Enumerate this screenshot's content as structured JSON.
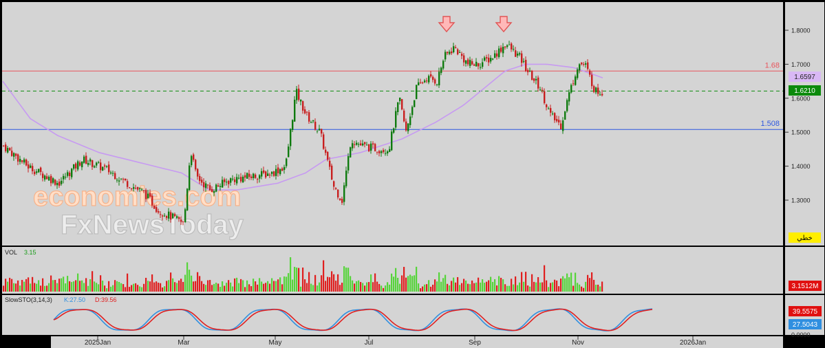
{
  "chart_data": [
    {
      "type": "candlestick",
      "panel": "price",
      "y_ticks": [
        "1.8000",
        "1.7000",
        "1.6000",
        "1.5000",
        "1.4000",
        "1.3000"
      ],
      "ylim": [
        1.2,
        1.85
      ],
      "x_ticks": [
        "2025Jan",
        "Mar",
        "May",
        "Jul",
        "Sep",
        "Nov",
        "2026Jan"
      ],
      "horizontal_lines": [
        {
          "label": "1.68",
          "value": 1.68,
          "color": "#e8545c"
        },
        {
          "label": "1.508",
          "value": 1.508,
          "color": "#2d57e0"
        },
        {
          "label": "1.6210",
          "value": 1.621,
          "color": "#0c8a0c",
          "style": "dashed"
        }
      ],
      "badges": [
        {
          "text": "1.6597",
          "bg": "#d9b8f5",
          "fg": "#222222"
        },
        {
          "text": "1.6210",
          "bg": "#0c8a0c",
          "fg": "#ffffff"
        },
        {
          "text": "خطي",
          "bg": "#ffee00",
          "fg": "#000000"
        }
      ],
      "close_trajectory_keypoints": [
        [
          0,
          1.46
        ],
        [
          35,
          1.4
        ],
        [
          80,
          1.35
        ],
        [
          115,
          1.42
        ],
        [
          150,
          1.39
        ],
        [
          180,
          1.35
        ],
        [
          205,
          1.32
        ],
        [
          225,
          1.27
        ],
        [
          245,
          1.25
        ],
        [
          262,
          1.23
        ],
        [
          272,
          1.45
        ],
        [
          280,
          1.37
        ],
        [
          300,
          1.33
        ],
        [
          330,
          1.36
        ],
        [
          360,
          1.37
        ],
        [
          390,
          1.38
        ],
        [
          410,
          1.4
        ],
        [
          425,
          1.62
        ],
        [
          440,
          1.55
        ],
        [
          460,
          1.5
        ],
        [
          480,
          1.34
        ],
        [
          492,
          1.3
        ],
        [
          505,
          1.48
        ],
        [
          520,
          1.46
        ],
        [
          545,
          1.45
        ],
        [
          560,
          1.45
        ],
        [
          575,
          1.6
        ],
        [
          585,
          1.5
        ],
        [
          600,
          1.63
        ],
        [
          615,
          1.66
        ],
        [
          630,
          1.65
        ],
        [
          640,
          1.72
        ],
        [
          655,
          1.75
        ],
        [
          675,
          1.7
        ],
        [
          690,
          1.7
        ],
        [
          710,
          1.72
        ],
        [
          730,
          1.76
        ],
        [
          750,
          1.72
        ],
        [
          765,
          1.67
        ],
        [
          780,
          1.63
        ],
        [
          795,
          1.55
        ],
        [
          810,
          1.52
        ],
        [
          820,
          1.6
        ],
        [
          835,
          1.7
        ],
        [
          845,
          1.7
        ],
        [
          860,
          1.62
        ],
        [
          872,
          1.62
        ]
      ],
      "ma_keypoints": [
        [
          0,
          1.65
        ],
        [
          40,
          1.54
        ],
        [
          80,
          1.49
        ],
        [
          140,
          1.44
        ],
        [
          200,
          1.41
        ],
        [
          260,
          1.38
        ],
        [
          300,
          1.33
        ],
        [
          340,
          1.33
        ],
        [
          400,
          1.35
        ],
        [
          440,
          1.38
        ],
        [
          470,
          1.42
        ],
        [
          520,
          1.44
        ],
        [
          580,
          1.48
        ],
        [
          630,
          1.53
        ],
        [
          670,
          1.58
        ],
        [
          700,
          1.63
        ],
        [
          730,
          1.68
        ],
        [
          760,
          1.7
        ],
        [
          790,
          1.7
        ],
        [
          830,
          1.69
        ],
        [
          872,
          1.66
        ]
      ],
      "arrows": [
        {
          "x_index": 645,
          "value": 1.84
        },
        {
          "x_index": 728,
          "value": 1.84
        }
      ]
    },
    {
      "type": "bar",
      "panel": "volume",
      "title": "VOL",
      "last_value": "3.15",
      "badge": "3.1512M"
    },
    {
      "type": "line",
      "panel": "oscillator",
      "title": "SlowSTO(3,14,3)",
      "k_label": "K:27.50",
      "d_label": "D:39.56",
      "badges": [
        "39.5575",
        "27.5043"
      ],
      "y_bottom_label": "0.0000",
      "series": [
        {
          "name": "K",
          "color": "#2f8fe0"
        },
        {
          "name": "D",
          "color": "#e02020"
        }
      ]
    }
  ],
  "watermark": {
    "line1": "economies.com",
    "line2": "FxNewsToday"
  }
}
